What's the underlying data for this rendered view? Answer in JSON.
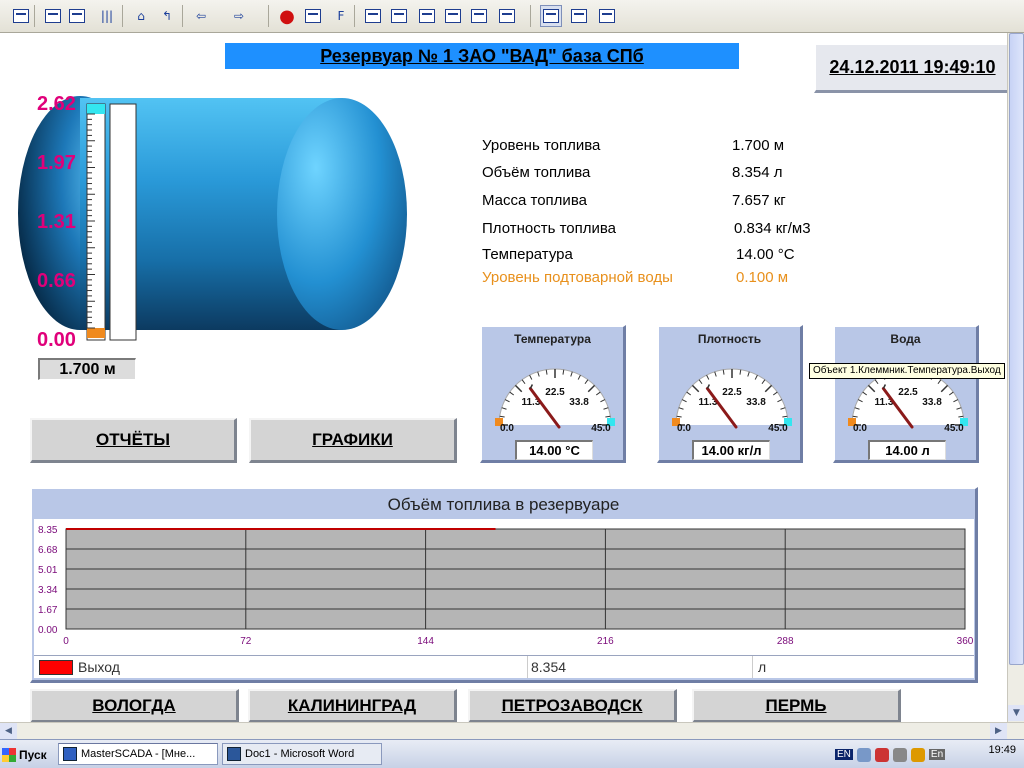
{
  "window": {
    "title": "Резервуар № 1  ЗАО \"ВАД\" база СПб",
    "datetime": "24.12.2011 19:49:10"
  },
  "toolbar": {
    "icons": [
      "window-icon",
      "table-icon",
      "network-icon",
      "bars-icon",
      "home-icon",
      "back-up-icon",
      "arrow-left-icon",
      "arrow-right-icon",
      "stop-icon",
      "print-icon",
      "f-icon",
      "binoculars-icon",
      "form-icon",
      "window-stack-icon",
      "properties-icon",
      "book-icon",
      "rectangle-icon",
      "chart-grid-icon",
      "chart-icon",
      "book-colored-icon"
    ]
  },
  "tank": {
    "scale_labels": [
      "2.62",
      "1.97",
      "1.31",
      "0.66",
      "0.00"
    ],
    "level_fraction": 0.65,
    "level_readout": "1.700 м",
    "colors": {
      "shell": "#1e8fd6",
      "scale_top": "#33e6f0",
      "scale_bottom": "#f08a1e"
    }
  },
  "params": [
    {
      "label": "Уровень топлива",
      "value": "1.700 м"
    },
    {
      "label": "Объём топлива",
      "value": "8.354 л"
    },
    {
      "label": "Масса топлива",
      "value": "7.657 кг"
    },
    {
      "label": "Плотность топлива",
      "value": "0.834 кг/м3"
    },
    {
      "label": "Температура",
      "value": "14.00 °C"
    },
    {
      "label": "Уровень подтоварной воды",
      "value": "0.100 м",
      "highlight": "#e8901c"
    }
  ],
  "buttons": {
    "reports": "ОТЧЁТЫ",
    "charts": "ГРАФИКИ"
  },
  "gauges": [
    {
      "title": "Температура",
      "min": "0.0",
      "max": "45.0",
      "ticks": [
        "11.3",
        "22.5",
        "33.8"
      ],
      "value": 14.0,
      "readout": "14.00 °C"
    },
    {
      "title": "Плотность",
      "min": "0.0",
      "max": "45.0",
      "ticks": [
        "11.3",
        "22.5",
        "33.8"
      ],
      "value": 14.0,
      "readout": "14.00 кг/л"
    },
    {
      "title": "Вода",
      "min": "0.0",
      "max": "45.0",
      "ticks": [
        "11.3",
        "22.5",
        "33.8"
      ],
      "value": 14.0,
      "readout": "14.00 л"
    }
  ],
  "tooltip": "Объект 1.Клеммник.Температура.Выход",
  "trend": {
    "title": "Объём топлива в резервуаре",
    "legend": {
      "name": "Выход",
      "value": "8.354",
      "unit": "л",
      "color": "#ff0000"
    }
  },
  "chart_data": {
    "type": "line",
    "title": "Объём топлива в резервуаре",
    "xlabel": "",
    "ylabel": "",
    "x_ticks": [
      "0",
      "72",
      "144",
      "216",
      "288",
      "360"
    ],
    "y_ticks": [
      "8.35",
      "6.68",
      "5.01",
      "3.34",
      "1.67",
      "0.00"
    ],
    "xlim": [
      0,
      360
    ],
    "ylim": [
      0,
      8.35
    ],
    "grid": true,
    "series": [
      {
        "name": "Выход",
        "x": [
          0,
          172
        ],
        "values": [
          8.35,
          8.35
        ],
        "color": "#c00000"
      }
    ]
  },
  "cities": [
    "ВОЛОГДА",
    "КАЛИНИНГРАД",
    "ПЕТРОЗАВОДСК",
    "ПЕРМЬ"
  ],
  "taskbar": {
    "start": "Пуск",
    "items": [
      "MasterSCADA - [Мне...",
      "Doc1 - Microsoft Word"
    ],
    "lang1": "EN",
    "lang2": "En",
    "clock": "19:49"
  }
}
